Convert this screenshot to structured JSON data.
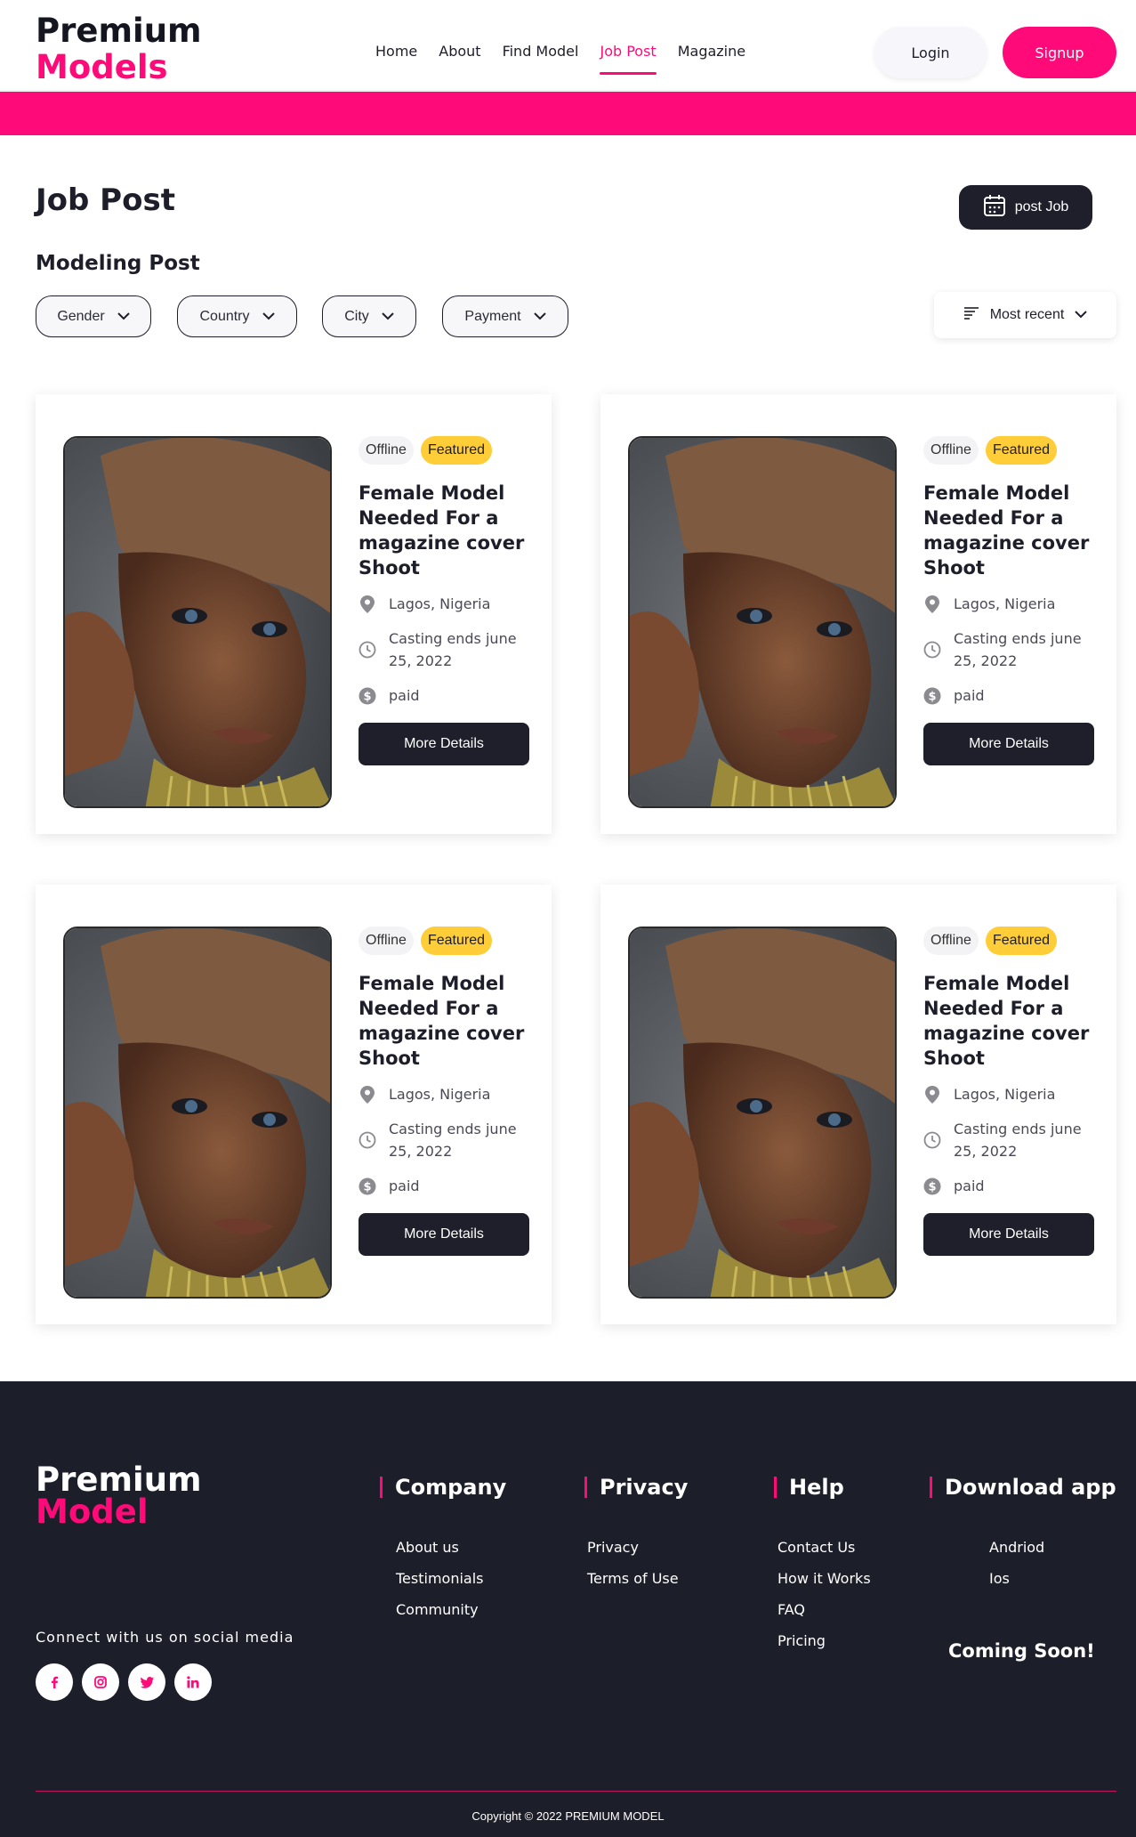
{
  "brand": {
    "line1": "Premium",
    "line2": "Models",
    "accent": "#ff0a78",
    "dark": "#1e1f2b"
  },
  "nav": [
    {
      "label": "Home"
    },
    {
      "label": "About"
    },
    {
      "label": "Find Model"
    },
    {
      "label": "Job Post",
      "active": true
    },
    {
      "label": "Magazine"
    }
  ],
  "auth": {
    "login": "Login",
    "signup": "Signup"
  },
  "page": {
    "title": "Job Post",
    "post_job": "post Job",
    "subtitle": "Modeling Post"
  },
  "filters": [
    {
      "label": "Gender"
    },
    {
      "label": "Country"
    },
    {
      "label": "City"
    },
    {
      "label": "Payment"
    }
  ],
  "sort": {
    "label": "Most recent"
  },
  "cards": [
    {
      "status": "Offline",
      "tag": "Featured",
      "title": "Female Model Needed For a magazine cover Shoot",
      "location": "Lagos, Nigeria",
      "deadline": "Casting ends june 25, 2022",
      "payment": "paid",
      "button": "More Details"
    },
    {
      "status": "Offline",
      "tag": "Featured",
      "title": "Female Model Needed For a magazine cover Shoot",
      "location": "Lagos, Nigeria",
      "deadline": "Casting ends june 25, 2022",
      "payment": "paid",
      "button": "More Details"
    },
    {
      "status": "Offline",
      "tag": "Featured",
      "title": "Female Model Needed For a magazine cover Shoot",
      "location": "Lagos, Nigeria",
      "deadline": "Casting ends june 25, 2022",
      "payment": "paid",
      "button": "More Details"
    },
    {
      "status": "Offline",
      "tag": "Featured",
      "title": "Female Model Needed For a magazine cover Shoot",
      "location": "Lagos, Nigeria",
      "deadline": "Casting ends june 25, 2022",
      "payment": "paid",
      "button": "More Details"
    }
  ],
  "footer": {
    "logo1": "Premium",
    "logo2": "Model",
    "social_label": "Connect with us on social media",
    "socials": [
      "facebook-icon",
      "instagram-icon",
      "twitter-icon",
      "linkedin-icon"
    ],
    "columns": [
      {
        "title": "Company",
        "links": [
          "About us",
          "Testimonials",
          "Community"
        ]
      },
      {
        "title": "Privacy",
        "links": [
          "Privacy",
          "Terms of Use"
        ]
      },
      {
        "title": "Help",
        "links": [
          "Contact Us",
          "How it Works",
          "FAQ",
          "Pricing"
        ]
      },
      {
        "title": "Download app",
        "links": [
          "Andriod",
          "Ios"
        ]
      }
    ],
    "coming_soon": "Coming Soon!",
    "copyright": "Copyright © 2022 PREMIUM MODEL"
  }
}
